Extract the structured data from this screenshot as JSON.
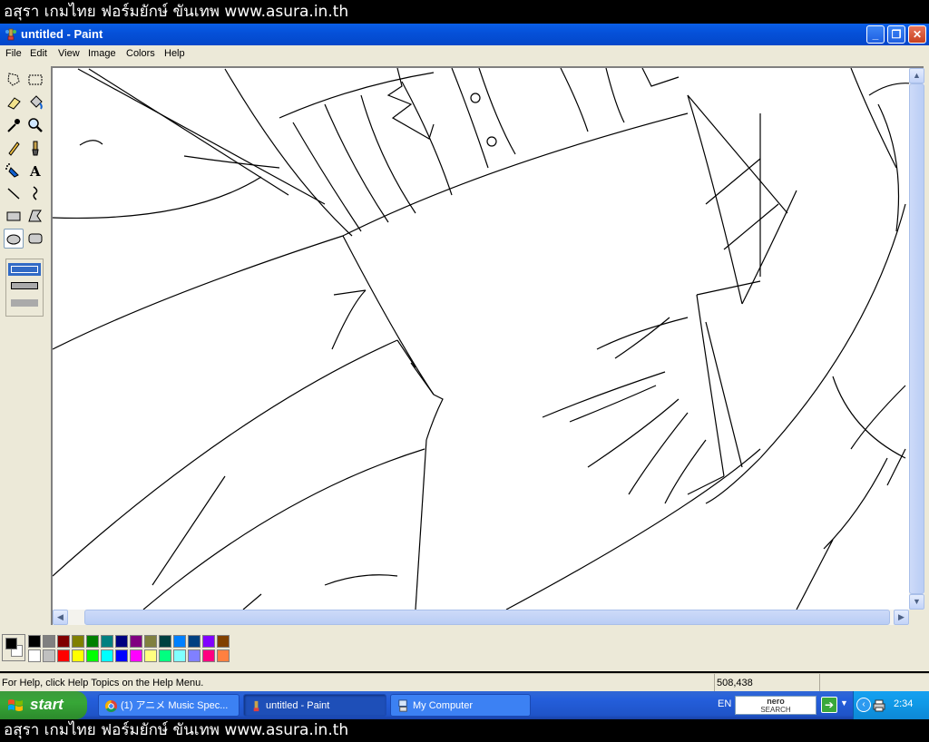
{
  "banner": {
    "top_text": "อสุรา เกมไทย ฟอร์มยักษ์ ขันเทพ www.asura.in.th",
    "bottom_text": "อสุรา เกมไทย ฟอร์มยักษ์ ขันเทพ www.asura.in.th"
  },
  "window": {
    "title": "untitled - Paint",
    "minimize": "_",
    "maximize": "❐",
    "close": "✕"
  },
  "menu": {
    "items": [
      "File",
      "Edit",
      "View",
      "Image",
      "Colors",
      "Help"
    ]
  },
  "tools": [
    {
      "name": "free-form-select-tool",
      "icon": "free-form-select-icon"
    },
    {
      "name": "rect-select-tool",
      "icon": "rect-select-icon"
    },
    {
      "name": "eraser-tool",
      "icon": "eraser-icon"
    },
    {
      "name": "fill-tool",
      "icon": "paint-bucket-icon"
    },
    {
      "name": "pick-color-tool",
      "icon": "eyedropper-icon"
    },
    {
      "name": "magnifier-tool",
      "icon": "magnifier-icon"
    },
    {
      "name": "pencil-tool",
      "icon": "pencil-icon"
    },
    {
      "name": "brush-tool",
      "icon": "brush-icon"
    },
    {
      "name": "airbrush-tool",
      "icon": "airbrush-icon"
    },
    {
      "name": "text-tool",
      "icon": "text-icon",
      "glyph": "A"
    },
    {
      "name": "line-tool",
      "icon": "line-icon"
    },
    {
      "name": "curve-tool",
      "icon": "curve-icon"
    },
    {
      "name": "rectangle-tool",
      "icon": "rectangle-icon"
    },
    {
      "name": "polygon-tool",
      "icon": "polygon-icon"
    },
    {
      "name": "ellipse-tool",
      "icon": "ellipse-icon",
      "selected": true
    },
    {
      "name": "rounded-rectangle-tool",
      "icon": "rounded-rectangle-icon"
    }
  ],
  "palette": {
    "foreground": "#000000",
    "background": "#ffffff",
    "colors_row1": [
      "#000000",
      "#808080",
      "#800000",
      "#808000",
      "#008000",
      "#008080",
      "#000080",
      "#800080",
      "#808040",
      "#004040",
      "#0080ff",
      "#004080",
      "#8000ff",
      "#804000"
    ],
    "colors_row2": [
      "#ffffff",
      "#c0c0c0",
      "#ff0000",
      "#ffff00",
      "#00ff00",
      "#00ffff",
      "#0000ff",
      "#ff00ff",
      "#ffff80",
      "#00ff80",
      "#80ffff",
      "#8080ff",
      "#ff0080",
      "#ff8040"
    ]
  },
  "status": {
    "help_text": "For Help, click Help Topics on the Help Menu.",
    "coords": "508,438"
  },
  "taskbar": {
    "start_label": "start",
    "tasks": [
      {
        "label": "(1) アニメ Music Spec...",
        "icon": "chrome-icon",
        "active": false
      },
      {
        "label": "untitled - Paint",
        "icon": "paint-icon",
        "active": true
      },
      {
        "label": "My Computer",
        "icon": "my-computer-icon",
        "active": false
      }
    ],
    "language": "EN",
    "nero_line1": "nero",
    "nero_line2": "SEARCH",
    "clock": "2:34"
  },
  "colors": {
    "title_blue": "#0550d8",
    "taskbar_blue": "#245edb",
    "start_green": "#37a737",
    "face": "#ece9d8"
  }
}
